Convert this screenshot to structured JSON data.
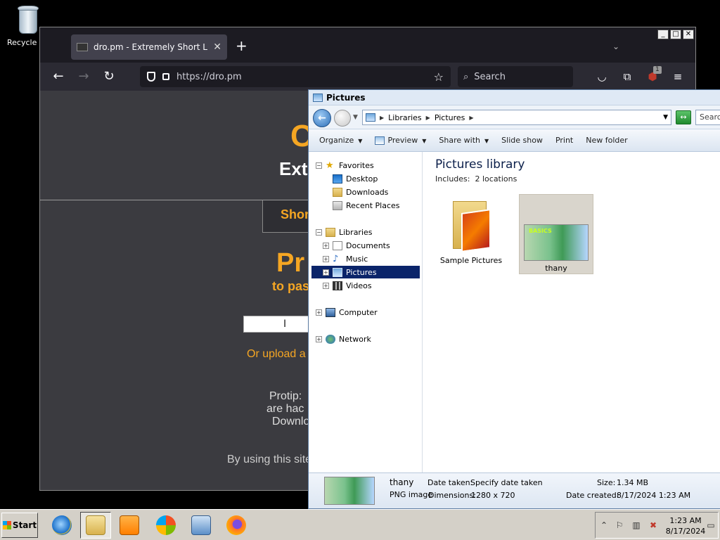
{
  "desktop": {
    "recycle_label": "Recycle Bin"
  },
  "firefox": {
    "tab_title": "dro.pm - Extremely Short Links",
    "url": "https://dro.pm",
    "search_placeholder": "Search",
    "addon_badge": "1",
    "page": {
      "logo_fragment": "C",
      "tagline_fragment": "Ext",
      "short_fragment": "Shor",
      "promo_fragment": "Pr",
      "promo_sub_fragment": "to pas",
      "upload_fragment": "Or upload a",
      "protip_lines": [
        "Protip: ",
        "are hac",
        "Downlo"
      ],
      "terms_fragment": "By using this site"
    }
  },
  "explorer": {
    "title": "Pictures",
    "breadcrumb": [
      "Libraries",
      "Pictures"
    ],
    "search_placeholder": "Searc",
    "commands": [
      "Organize",
      "Preview",
      "Share with",
      "Slide show",
      "Print",
      "New folder"
    ],
    "nav": {
      "favorites": "Favorites",
      "desktop": "Desktop",
      "downloads": "Downloads",
      "recent": "Recent Places",
      "libraries": "Libraries",
      "documents": "Documents",
      "music": "Music",
      "pictures": "Pictures",
      "videos": "Videos",
      "computer": "Computer",
      "network": "Network"
    },
    "library_title": "Pictures library",
    "includes_label": "Includes:",
    "includes_value": "2 locations",
    "items": [
      {
        "name": "Sample Pictures",
        "type": "folder"
      },
      {
        "name": "thany",
        "type": "image"
      }
    ],
    "thumb_text": "BASICS",
    "details": {
      "name": "thany",
      "type": "PNG image",
      "date_taken_label": "Date taken:",
      "date_taken_value": "Specify date taken",
      "dimensions_label": "Dimensions:",
      "dimensions_value": "1280 x 720",
      "size_label": "Size:",
      "size_value": "1.34 MB",
      "created_label": "Date created:",
      "created_value": "8/17/2024 1:23 AM"
    }
  },
  "taskbar": {
    "start_label": "Start",
    "time": "1:23 AM",
    "date": "8/17/2024"
  },
  "colors": {
    "accent_orange": "#f5a623",
    "selection_blue": "#0a246a"
  }
}
